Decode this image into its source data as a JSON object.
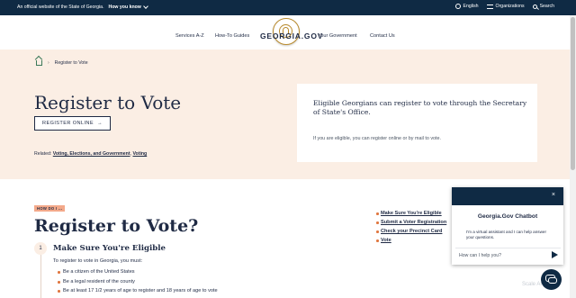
{
  "utility_bar": {
    "official_text": "An official website of the State of Georgia.",
    "how_you_know": "How you know",
    "language": "English",
    "organizations": "Organizations",
    "search": "Search"
  },
  "nav": {
    "services": "Services A-Z",
    "how_to": "How-To Guides",
    "brand": "GEORGIA.GOV",
    "your_government": "Your Government",
    "contact": "Contact Us"
  },
  "breadcrumb": {
    "current": "Register to Vote"
  },
  "hero": {
    "title": "Register to Vote",
    "button_label": "REGISTER ONLINE",
    "button_arrow": "→",
    "related_label": "Related:",
    "related_links": [
      "Voting, Elections, and Government",
      "Voting"
    ],
    "card_heading": "Eligible Georgians can register to vote through the Secretary of State's Office.",
    "card_body": "If you are eligible, you can register online or by mail to vote."
  },
  "main": {
    "tag": "HOW DO I ...",
    "title": "Register to Vote?",
    "step_number": "1",
    "step_title": "Make Sure You're Eligible",
    "step_intro": "To register to vote in Georgia, you must:",
    "requirements": [
      "Be a citizen of the United States",
      "Be a legal resident of the county",
      "Be at least 17 1/2 years of age to register and 18 years of age to vote"
    ]
  },
  "jump_links": [
    "Make Sure You're Eligible",
    "Submit a Voter Registration",
    "Check your Precinct Card",
    "Vote"
  ],
  "chatbot": {
    "close": "×",
    "title": "Georgia.Gov Chatbot",
    "message": "I'm a virtual assistant and I can help answer your questions.",
    "input_placeholder": "How can I help you?"
  },
  "watermark": "Scale AI"
}
